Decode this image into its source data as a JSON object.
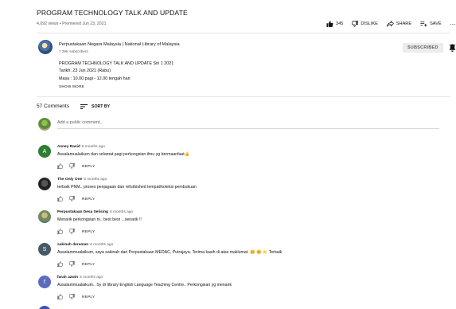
{
  "video": {
    "title": "PROGRAM TECHNOLOGY TALK AND UPDATE",
    "meta": "4,092 views • Premiered Jun 23, 2021",
    "likes": "345",
    "dislike_label": "DISLIKE",
    "share_label": "SHARE",
    "save_label": "SAVE",
    "more_label": "..."
  },
  "channel": {
    "name": "Perpustakaan Negara Malaysia | National Library of Malaysia",
    "subscribers": "7.39K subscribers",
    "subscribe_label": "SUBSCRIBED"
  },
  "description": {
    "line1": "PROGRAM TECHNOLOGY TALK AND UPDATE Siri 1 2021",
    "line2": "Tarikh: 23 Jun 2021 (Rabu)",
    "line3": "Masa : 10.00 pagi - 12.00 tengah hari",
    "show_more": "SHOW MORE"
  },
  "comments_section": {
    "count_label": "57 Comments",
    "sort_label": "SORT BY",
    "add_placeholder": "Add a public comment..."
  },
  "comments": [
    {
      "author": "Asney Rasid",
      "ago": "6 months ago",
      "text": "Assalamualaikum dan selamat pagi perkongsian ilmu yg bermaanfaat👍",
      "avatar_letter": "A",
      "avatar_color": "#2e7d32",
      "reply": "REPLY"
    },
    {
      "author": "The Only One",
      "ago": "6 months ago",
      "text": "terbaik PNM.. proses penjagaan dan  refurbished tempat/koleksi pembukuan",
      "avatar_letter": "",
      "avatar_color": "#3a3a3a",
      "reply": "REPLY"
    },
    {
      "author": "Perpustakaan Desa Selising",
      "ago": "6 months ago",
      "text": "Menarik perkongsian ni.. best best ...senarik !!",
      "avatar_letter": "",
      "avatar_color": "#7a8c6a",
      "reply": "REPLY"
    },
    {
      "author": "sakinah deraman",
      "ago": "6 months ago",
      "text": "Assalammualaikum, saya sakinah dari Perpustakaan MEDAC, Putrajaya. Terima kasih di atas maklumat. 😊 😊 ⭐ Terbaik",
      "avatar_letter": "S",
      "avatar_color": "#455a64",
      "reply": "REPLY"
    },
    {
      "author": "farah azwin",
      "ago": "6 months ago",
      "text": "Assalammualaikum.. Sy dr library English Language Teaching Centre.. Perkongsian yg menarik",
      "avatar_letter": "f",
      "avatar_color": "#5c6bc0",
      "reply": "REPLY"
    }
  ]
}
